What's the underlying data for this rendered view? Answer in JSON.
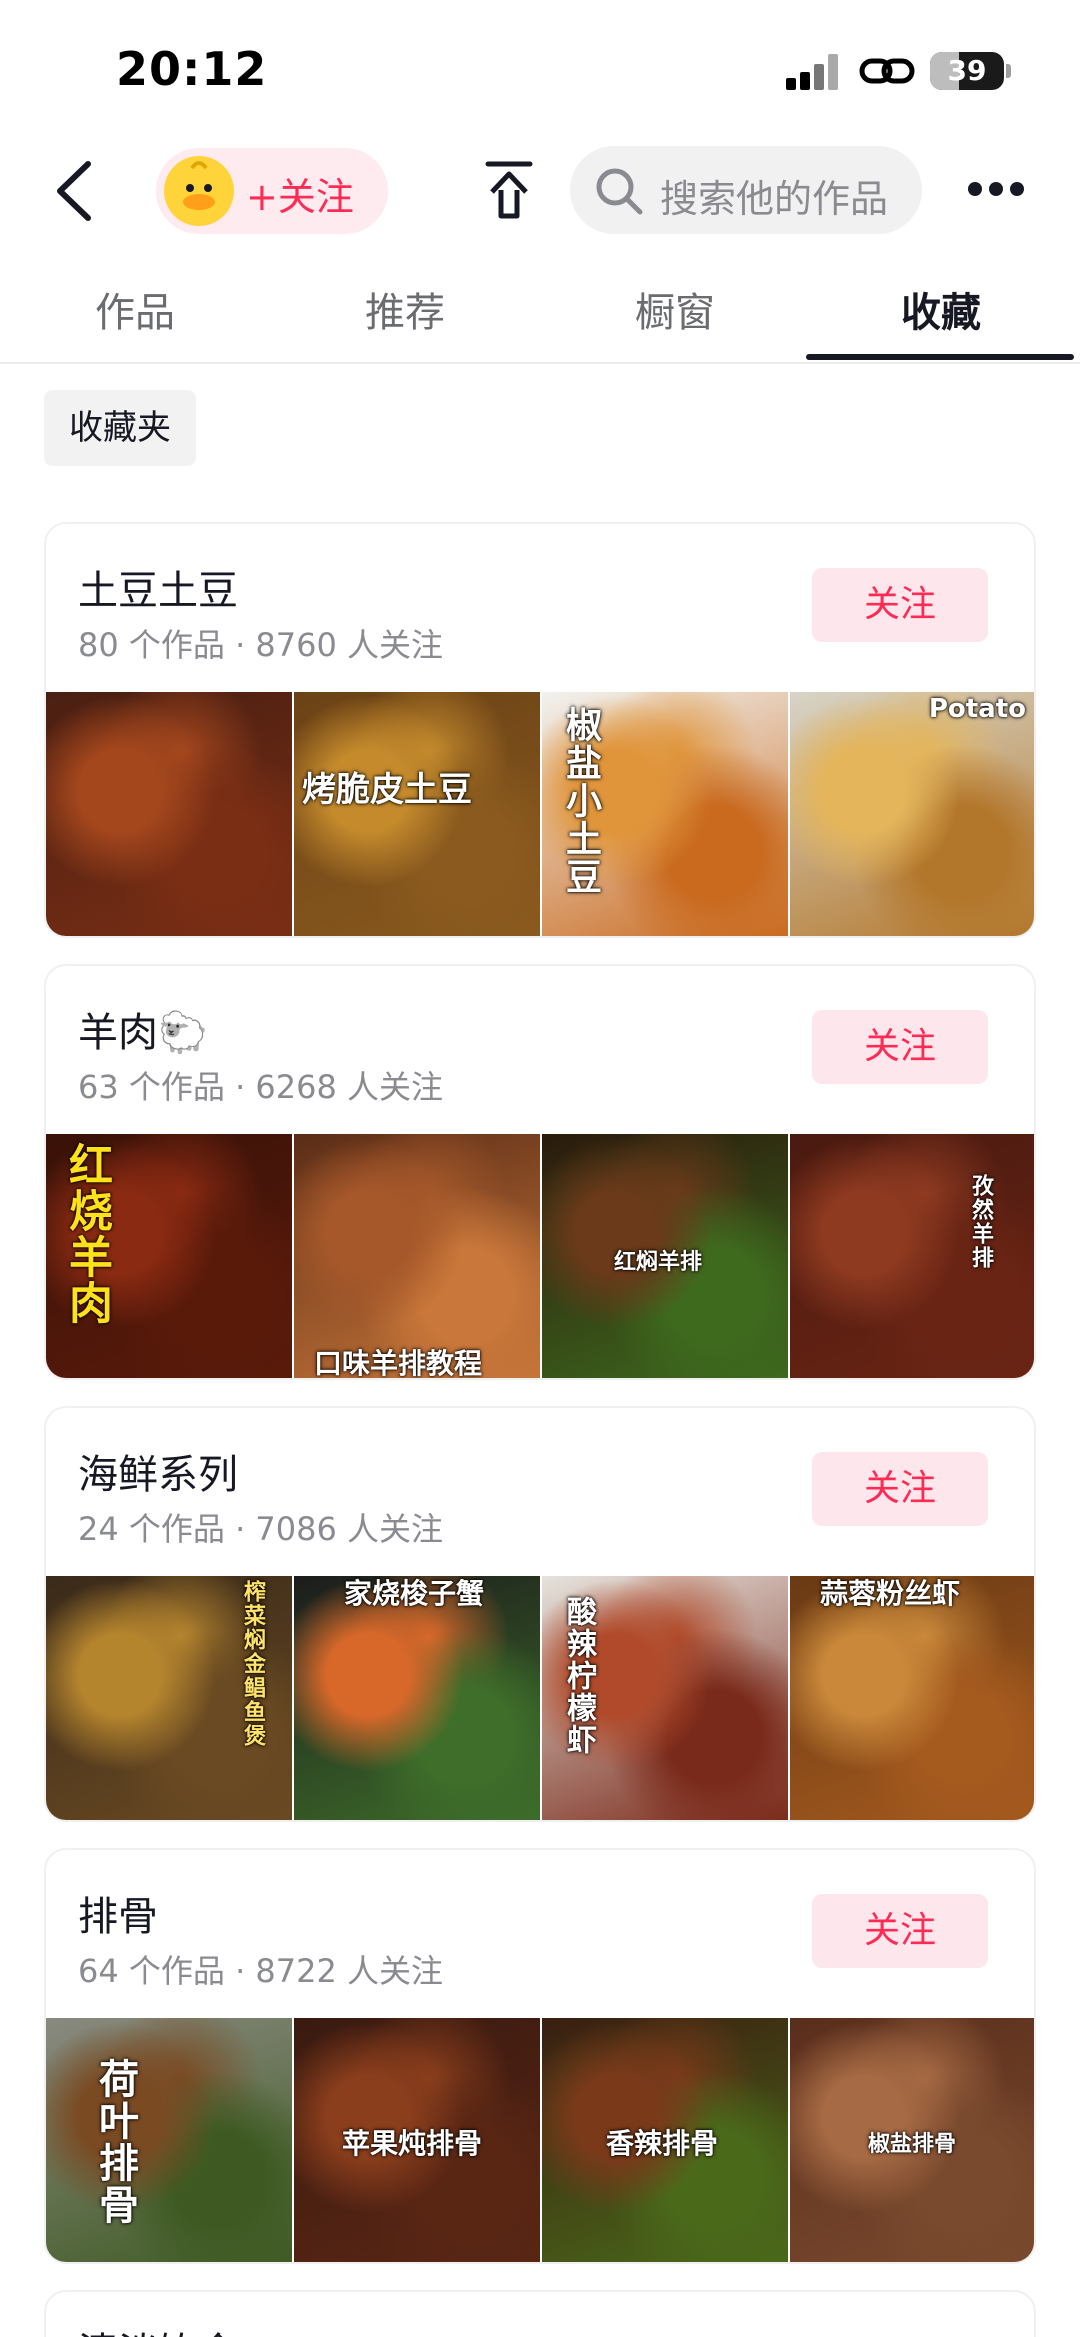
{
  "status_bar": {
    "time": "20:12",
    "battery": "39",
    "battery_level": 0.39
  },
  "header": {
    "follow_label": "+关注",
    "search_placeholder": "搜索他的作品"
  },
  "tabs": [
    {
      "label": "作品",
      "active": false
    },
    {
      "label": "推荐",
      "active": false
    },
    {
      "label": "橱窗",
      "active": false
    },
    {
      "label": "收藏",
      "active": true
    }
  ],
  "folder_chip": "收藏夹",
  "collections": [
    {
      "title": "土豆土豆",
      "meta": "80 个作品 · 8760 人关注",
      "follow_label": "关注",
      "thumbnails": [
        {
          "caption": "",
          "colors": [
            "#4a1f12",
            "#a4471d",
            "#7a2e14"
          ]
        },
        {
          "caption": "烤脆皮土豆",
          "colors": [
            "#6b4216",
            "#c48a2c",
            "#8a5a1e"
          ]
        },
        {
          "caption": "椒盐小土豆",
          "colors": [
            "#f2f2ef",
            "#e0953a",
            "#c96a1f"
          ]
        },
        {
          "caption": "Potato",
          "colors": [
            "#d8d4c7",
            "#e4b55a",
            "#b3772c"
          ]
        }
      ]
    },
    {
      "title": "羊肉🐑",
      "meta": "63 个作品 · 6268 人关注",
      "follow_label": "关注",
      "thumbnails": [
        {
          "caption": "红烧羊肉",
          "colors": [
            "#3a1208",
            "#8a2a12",
            "#5a1a0a"
          ]
        },
        {
          "caption": "口味羊排教程",
          "colors": [
            "#5a2c16",
            "#a6582a",
            "#c9773a"
          ]
        },
        {
          "caption": "红焖羊排",
          "colors": [
            "#2a1a0c",
            "#6a3a1a",
            "#3e6a1e"
          ]
        },
        {
          "caption": "孜然羊排",
          "colors": [
            "#4a1a10",
            "#8e3a20",
            "#6a2414"
          ]
        }
      ]
    },
    {
      "title": "海鲜系列",
      "meta": "24 个作品 · 7086 人关注",
      "follow_label": "关注",
      "thumbnails": [
        {
          "caption": "榨菜焖金鲳鱼煲",
          "colors": [
            "#3a2a1a",
            "#b5852e",
            "#6a4a22"
          ]
        },
        {
          "caption": "家烧梭子蟹",
          "colors": [
            "#1c1c1c",
            "#d8682a",
            "#3e6e2a"
          ]
        },
        {
          "caption": "酸辣柠檬虾",
          "colors": [
            "#e6e2dc",
            "#b04a2a",
            "#7a2a1a"
          ]
        },
        {
          "caption": "蒜蓉粉丝虾",
          "colors": [
            "#6a3a14",
            "#c9883a",
            "#a55a1e"
          ]
        }
      ]
    },
    {
      "title": "排骨",
      "meta": "64 个作品 · 8722 人关注",
      "follow_label": "关注",
      "thumbnails": [
        {
          "caption": "荷叶排骨",
          "colors": [
            "#8a8a80",
            "#7a4a22",
            "#3e5a22"
          ]
        },
        {
          "caption": "苹果炖排骨",
          "colors": [
            "#3a1a10",
            "#8a3e1c",
            "#5a2614"
          ]
        },
        {
          "caption": "香辣排骨",
          "colors": [
            "#3a1e10",
            "#7a3a1a",
            "#4a6a1a"
          ]
        },
        {
          "caption": "椒盐排骨",
          "colors": [
            "#5a2e1c",
            "#a66a44",
            "#7a4a2e"
          ]
        }
      ]
    },
    {
      "title": "清淡饮食",
      "meta": "",
      "follow_label": "",
      "thumbnails": []
    }
  ],
  "colors": {
    "accent": "#fe2c55",
    "accent_bg": "#fde6ec",
    "text": "#161823",
    "muted": "#8a8b91"
  }
}
